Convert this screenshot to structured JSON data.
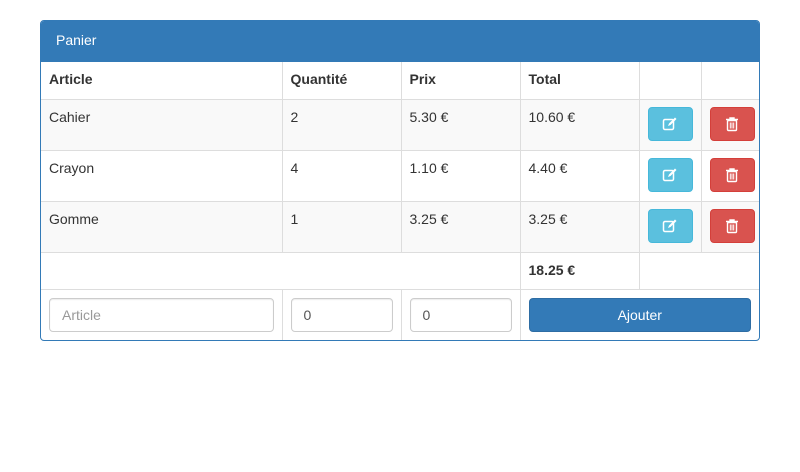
{
  "panel": {
    "title": "Panier"
  },
  "table": {
    "headers": {
      "article": "Article",
      "quantite": "Quantité",
      "prix": "Prix",
      "total": "Total"
    },
    "rows": [
      {
        "article": "Cahier",
        "quantite": "2",
        "prix": "5.30 €",
        "total": "10.60 €"
      },
      {
        "article": "Crayon",
        "quantite": "4",
        "prix": "1.10 €",
        "total": "4.40 €"
      },
      {
        "article": "Gomme",
        "quantite": "1",
        "prix": "3.25 €",
        "total": "3.25 €"
      }
    ],
    "grand_total": "18.25 €"
  },
  "form": {
    "article_placeholder": "Article",
    "article_value": "",
    "quantite_value": "0",
    "prix_value": "0",
    "add_label": "Ajouter"
  },
  "icons": {
    "edit": "pencil-square-icon",
    "delete": "trash-icon"
  },
  "colors": {
    "primary": "#337ab7",
    "info": "#5bc0de",
    "danger": "#d9534f"
  }
}
